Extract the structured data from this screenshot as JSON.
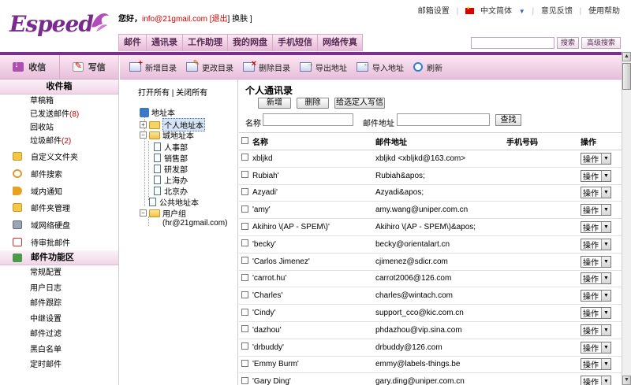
{
  "header": {
    "logo_text": "Espeed",
    "greeting_label": "您好，",
    "email": "info@21gmail.com",
    "logout_label": "[退出",
    "skin_label": "换肤 ]",
    "top_links": {
      "mail_settings": "邮箱设置",
      "language": "中文简体",
      "feedback": "意见反馈",
      "help": "使用帮助"
    },
    "nav_tabs": [
      "邮件",
      "通讯录",
      "工作助理",
      "我的网盘",
      "手机短信",
      "网络传真"
    ],
    "search_button": "搜索",
    "advanced_search_button": "高级搜索"
  },
  "sidebar": {
    "receive_label": "收信",
    "write_label": "写信",
    "inbox_label": "收件箱",
    "folders": [
      {
        "label": "草稿箱",
        "count": ""
      },
      {
        "label": "已发送邮件",
        "count": "(8)"
      },
      {
        "label": "回收站",
        "count": ""
      },
      {
        "label": "垃圾邮件",
        "count": "(2)"
      }
    ],
    "tools": [
      {
        "label": "自定义文件夹",
        "icon": "folder-icon"
      },
      {
        "label": "邮件搜索",
        "icon": "search-icon"
      },
      {
        "label": "域内通知",
        "icon": "speaker-icon"
      },
      {
        "label": "邮件夹管理",
        "icon": "folder-icon"
      },
      {
        "label": "域网络硬盘",
        "icon": "disk-icon"
      },
      {
        "label": "待审批邮件",
        "icon": "mail-icon"
      }
    ],
    "functions_header": "邮件功能区",
    "functions": [
      "常规配置",
      "用户日志",
      "邮件跟踪",
      "中继设置",
      "邮件过滤",
      "黑白名单",
      "定时邮件"
    ]
  },
  "toolbar": {
    "items": [
      "新增目录",
      "更改目录",
      "删除目录",
      "导出地址",
      "导入地址",
      "刷新"
    ]
  },
  "tree": {
    "open_all": "打开所有",
    "close_all": "| 关闭所有",
    "root": "地址本",
    "personal": "个人地址本",
    "domain": "城地址本",
    "departments": [
      "人事部",
      "销售部",
      "研发部",
      "上海办",
      "北京办"
    ],
    "public": "公共地址本",
    "user_group": "用户组",
    "user_entry": "(hr@21gmail.com)"
  },
  "content": {
    "title": "个人通讯录",
    "new_button": "新增",
    "delete_button": "删除",
    "write_to_button": "给选定人写信",
    "name_label": "名称",
    "address_label": "邮件地址",
    "find_button": "查找",
    "columns": {
      "name": "名称",
      "address": "邮件地址",
      "phone": "手机号码",
      "operation": "操作"
    },
    "operation_label": "操作",
    "rows": [
      {
        "name": "xbljkd",
        "address": "xbljkd <xbljkd@163.com>"
      },
      {
        "name": "Rubiah'",
        "address": "Rubiah&apos;"
      },
      {
        "name": "Azyadi'",
        "address": "Azyadi&apos;"
      },
      {
        "name": "'amy'",
        "address": "amy.wang@uniper.com.cn"
      },
      {
        "name": "Akihiro \\(AP - SPEM\\)'",
        "address": "Akihiro \\(AP - SPEM\\)&apos;"
      },
      {
        "name": "'becky'",
        "address": "becky@orientalart.cn"
      },
      {
        "name": "'Carlos Jimenez'",
        "address": "cjimenez@sdicr.com"
      },
      {
        "name": "'carrot.hu'",
        "address": "carrot2006@126.com"
      },
      {
        "name": "'Charles'",
        "address": "charles@wintach.com"
      },
      {
        "name": "'Cindy'",
        "address": "support_cco@kic.com.cn"
      },
      {
        "name": "'dazhou'",
        "address": "phdazhou@vip.sina.com"
      },
      {
        "name": "'drbuddy'",
        "address": "drbuddy@126.com"
      },
      {
        "name": "'Emmy Burm'",
        "address": "emmy@labels-things.be"
      },
      {
        "name": "'Gary Ding'",
        "address": "gary.ding@uniper.com.cn"
      }
    ]
  },
  "colors": {
    "brand_purple": "#7b2f8e",
    "alert_red": "#cc0000"
  }
}
